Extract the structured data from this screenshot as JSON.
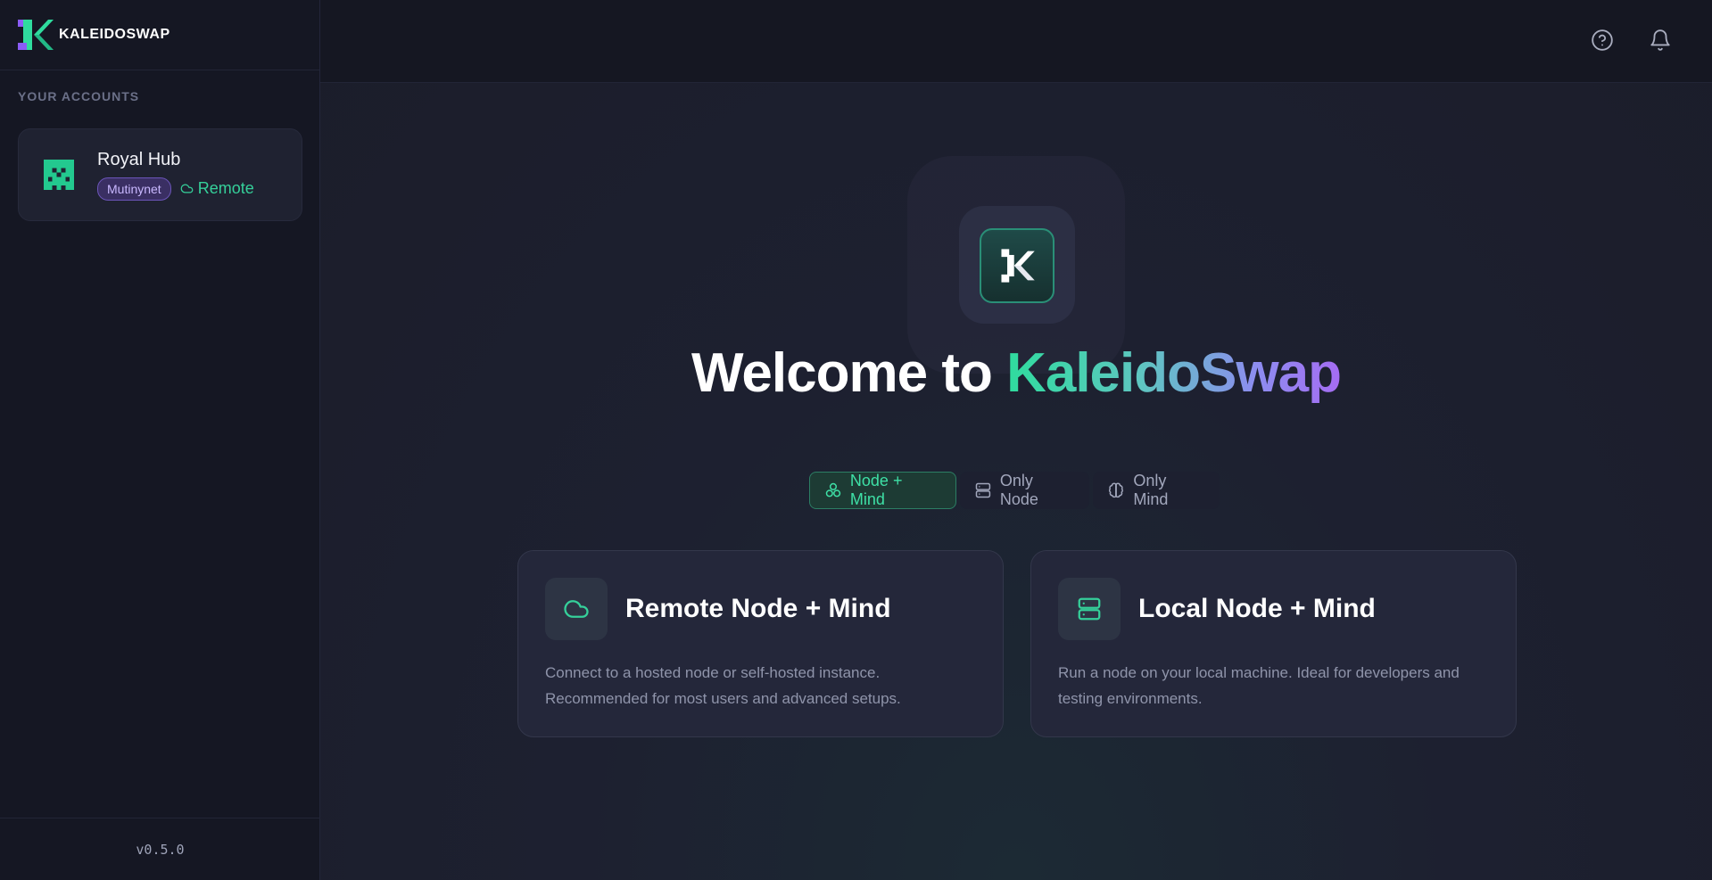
{
  "sidebar": {
    "brand_name": "KALEIDOSWAP",
    "section_label": "YOUR ACCOUNTS",
    "accounts": [
      {
        "name": "Royal Hub",
        "network": "Mutinynet",
        "connection": "Remote"
      }
    ],
    "version": "v0.5.0"
  },
  "topbar": {
    "help_icon": "help-circle-icon",
    "notifications_icon": "bell-icon"
  },
  "hero": {
    "welcome_prefix": "Welcome to ",
    "welcome_brand": "KaleidoSwap"
  },
  "mode_tabs": [
    {
      "label": "Node + Mind",
      "icon": "node-mind-icon",
      "active": true
    },
    {
      "label": "Only Node",
      "icon": "server-icon",
      "active": false
    },
    {
      "label": "Only Mind",
      "icon": "brain-icon",
      "active": false
    }
  ],
  "cards": [
    {
      "title": "Remote Node + Mind",
      "icon": "cloud-icon",
      "description": "Connect to a hosted node or self-hosted instance. Recommended for most users and advanced setups."
    },
    {
      "title": "Local Node + Mind",
      "icon": "server-icon",
      "description": "Run a node on your local machine. Ideal for developers and testing environments."
    }
  ],
  "colors": {
    "accent_green": "#35d09a",
    "accent_purple": "#a56cf2",
    "network_badge": "#3a2f63"
  }
}
